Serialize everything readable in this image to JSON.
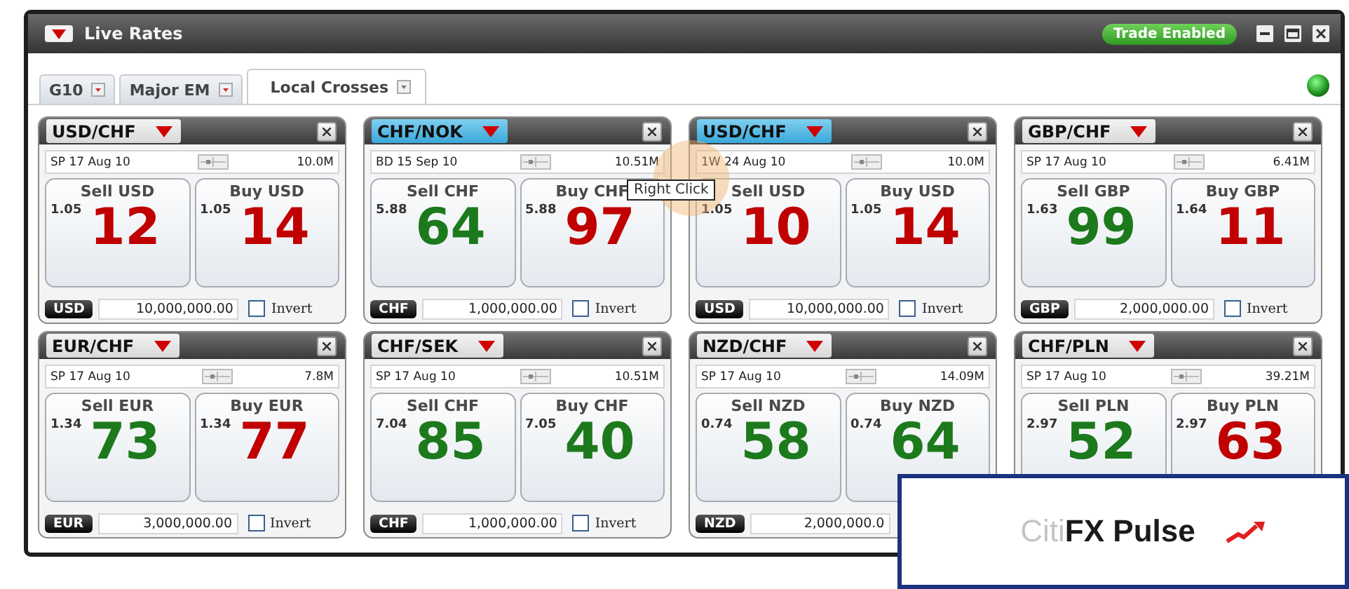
{
  "window": {
    "title": "Live Rates",
    "trade_badge": "Trade Enabled"
  },
  "tabs": [
    {
      "label": "G10",
      "selected": false
    },
    {
      "label": "Major EM",
      "selected": false
    },
    {
      "label": "Local Crosses",
      "selected": true
    }
  ],
  "status_light": {
    "on": true
  },
  "tiles": [
    {
      "pair": "USD/CHF",
      "selected": false,
      "date": "SP 17 Aug 10",
      "size": "10.0M",
      "sell": {
        "label": "Sell USD",
        "big_figure": "1.05",
        "pips": "12",
        "color": "#c00000"
      },
      "buy": {
        "label": "Buy USD",
        "big_figure": "1.05",
        "pips": "14",
        "color": "#c00000"
      },
      "currency": "USD",
      "amount": "10,000,000.00",
      "invert": {
        "label": "Invert",
        "checked": false
      }
    },
    {
      "pair": "CHF/NOK",
      "selected": true,
      "date": "BD 15 Sep 10",
      "size": "10.51M",
      "sell": {
        "label": "Sell CHF",
        "big_figure": "5.88",
        "pips": "64",
        "color": "#1c7a1c"
      },
      "buy": {
        "label": "Buy CHF",
        "big_figure": "5.88",
        "pips": "97",
        "color": "#c00000"
      },
      "currency": "CHF",
      "amount": "1,000,000.00",
      "invert": {
        "label": "Invert",
        "checked": false
      }
    },
    {
      "pair": "USD/CHF",
      "selected": true,
      "date": "1W 24 Aug 10",
      "size": "10.0M",
      "sell": {
        "label": "Sell USD",
        "big_figure": "1.05",
        "pips": "10",
        "color": "#c00000"
      },
      "buy": {
        "label": "Buy USD",
        "big_figure": "1.05",
        "pips": "14",
        "color": "#c00000"
      },
      "currency": "USD",
      "amount": "10,000,000.00",
      "invert": {
        "label": "Invert",
        "checked": false
      }
    },
    {
      "pair": "GBP/CHF",
      "selected": false,
      "date": "SP 17 Aug 10",
      "size": "6.41M",
      "sell": {
        "label": "Sell GBP",
        "big_figure": "1.63",
        "pips": "99",
        "color": "#1c7a1c"
      },
      "buy": {
        "label": "Buy GBP",
        "big_figure": "1.64",
        "pips": "11",
        "color": "#c00000"
      },
      "currency": "GBP",
      "amount": "2,000,000.00",
      "invert": {
        "label": "Invert",
        "checked": false
      }
    },
    {
      "pair": "EUR/CHF",
      "selected": false,
      "date": "SP 17 Aug 10",
      "size": "7.8M",
      "sell": {
        "label": "Sell EUR",
        "big_figure": "1.34",
        "pips": "73",
        "color": "#1c7a1c"
      },
      "buy": {
        "label": "Buy EUR",
        "big_figure": "1.34",
        "pips": "77",
        "color": "#c00000"
      },
      "currency": "EUR",
      "amount": "3,000,000.00",
      "invert": {
        "label": "Invert",
        "checked": false
      }
    },
    {
      "pair": "CHF/SEK",
      "selected": false,
      "date": "SP 17 Aug 10",
      "size": "10.51M",
      "sell": {
        "label": "Sell CHF",
        "big_figure": "7.04",
        "pips": "85",
        "color": "#1c7a1c"
      },
      "buy": {
        "label": "Buy CHF",
        "big_figure": "7.05",
        "pips": "40",
        "color": "#1c7a1c"
      },
      "currency": "CHF",
      "amount": "1,000,000.00",
      "invert": {
        "label": "Invert",
        "checked": false
      }
    },
    {
      "pair": "NZD/CHF",
      "selected": false,
      "date": "SP 17 Aug 10",
      "size": "14.09M",
      "sell": {
        "label": "Sell NZD",
        "big_figure": "0.74",
        "pips": "58",
        "color": "#1c7a1c"
      },
      "buy": {
        "label": "Buy NZD",
        "big_figure": "0.74",
        "pips": "64",
        "color": "#1c7a1c"
      },
      "currency": "NZD",
      "amount": "2,000,000.0"
    },
    {
      "pair": "CHF/PLN",
      "selected": false,
      "date": "SP 17 Aug 10",
      "size": "39.21M",
      "sell": {
        "label": "Sell PLN",
        "big_figure": "2.97",
        "pips": "52",
        "color": "#1c7a1c"
      },
      "buy": {
        "label": "Buy PLN",
        "big_figure": "2.97",
        "pips": "63",
        "color": "#c00000"
      }
    }
  ],
  "tooltip": "Right Click",
  "logo_overlay": {
    "text": "Citi**FX Pulse**"
  }
}
